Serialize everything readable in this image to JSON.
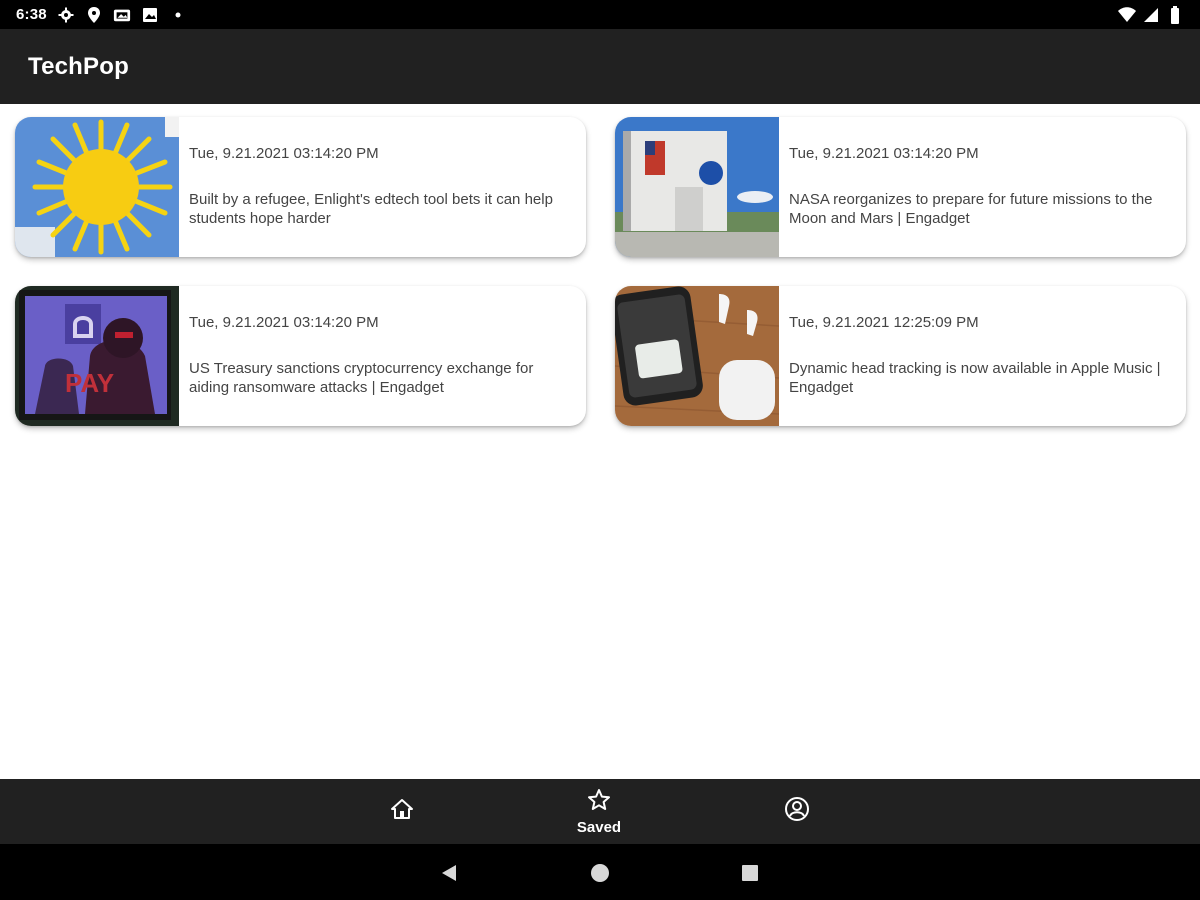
{
  "status_bar": {
    "time": "6:38",
    "icons": [
      "gear-icon",
      "location-icon",
      "photos-icon",
      "image-icon",
      "dot-icon",
      "wifi-icon",
      "signal-icon",
      "battery-icon"
    ]
  },
  "app_bar": {
    "title": "TechPop"
  },
  "articles": [
    {
      "date": "Tue, 9.21.2021 03:14:20 PM",
      "title": "Built by a refugee, Enlight's edtech tool bets it can help students hope harder",
      "thumb": "sun-drawing-image"
    },
    {
      "date": "Tue, 9.21.2021 03:14:20 PM",
      "title": "NASA reorganizes to prepare for future missions to the Moon and Mars | Engadget",
      "thumb": "nasa-building-image"
    },
    {
      "date": "Tue, 9.21.2021 03:14:20 PM",
      "title": "US Treasury sanctions cryptocurrency exchange for aiding ransomware attacks | Engadget",
      "thumb": "ransomware-laptop-image"
    },
    {
      "date": "Tue, 9.21.2021 12:25:09 PM",
      "title": "Dynamic head tracking is now available in Apple Music | Engadget",
      "thumb": "airpods-iphone-image"
    }
  ],
  "bottom_nav": {
    "items": [
      {
        "icon": "home-icon",
        "label": ""
      },
      {
        "icon": "star-icon",
        "label": "Saved"
      },
      {
        "icon": "account-icon",
        "label": ""
      }
    ]
  },
  "system_nav": {
    "buttons": [
      "back-icon",
      "home-circle-icon",
      "recents-icon"
    ]
  },
  "colors": {
    "app_bar": "#212121",
    "status_bar": "#000000",
    "text": "#444444",
    "background": "#ffffff"
  }
}
